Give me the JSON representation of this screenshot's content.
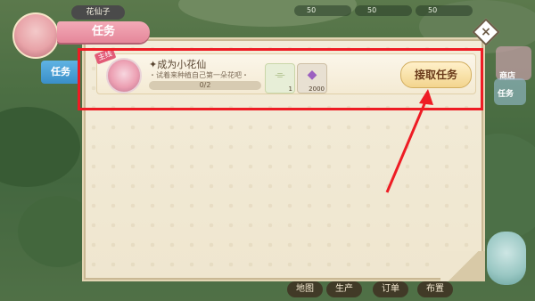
{
  "player": {
    "name": "花仙子"
  },
  "hud": {
    "values": [
      "50",
      "50",
      "50"
    ]
  },
  "side": {
    "shop_label": "商店",
    "task_label": "任务"
  },
  "panel": {
    "title": "任务",
    "side_tab": "任务",
    "close_icon": "×"
  },
  "quest": {
    "badge": "主线",
    "title": "成为小花仙",
    "description": "试着来种植自己第一朵花吧",
    "progress_text": "0/2",
    "progress_fraction": 0.0,
    "rewards": [
      {
        "icon": "seed-icon",
        "count": "1"
      },
      {
        "icon": "gem-icon",
        "count": "2000"
      }
    ],
    "accept_label": "接取任务"
  },
  "bottom_menu": [
    "地图",
    "生产",
    "订单",
    "布置"
  ],
  "colors": {
    "highlight": "#ee1c24",
    "title_tab": "#e5879a",
    "side_tab": "#3a8fc8"
  }
}
